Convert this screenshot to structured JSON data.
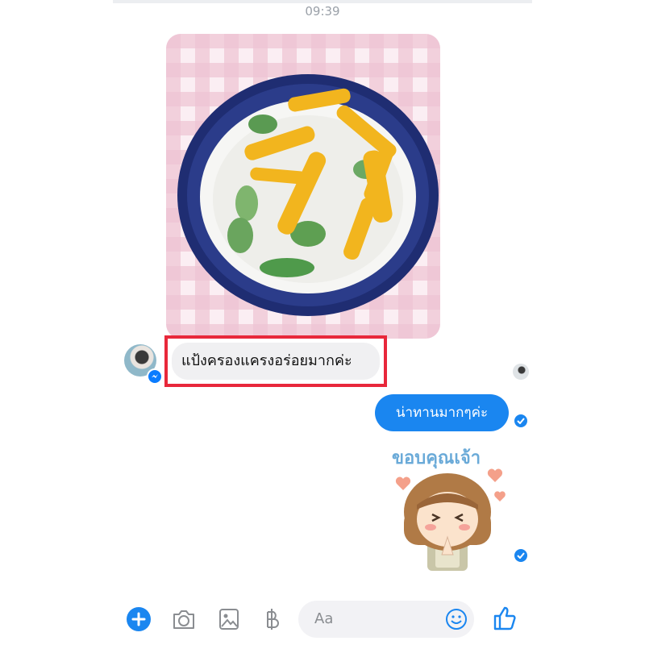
{
  "status": {
    "time": "09:39"
  },
  "conversation": {
    "photo_description_icon": "dessert-photo",
    "incoming_message": "แป้งครองแครงอร่อยมากค่ะ",
    "outgoing_message": "น่าทานมากๆค่ะ",
    "sticker_text": "ขอบคุณเจ้า"
  },
  "composer": {
    "placeholder": "Aa",
    "icons": [
      "plus-icon",
      "camera-icon",
      "gallery-icon",
      "baht-icon",
      "emoji-icon",
      "thumbs-up-icon"
    ]
  },
  "colors": {
    "accent": "#1a86f0",
    "highlight": "#e8283b"
  }
}
